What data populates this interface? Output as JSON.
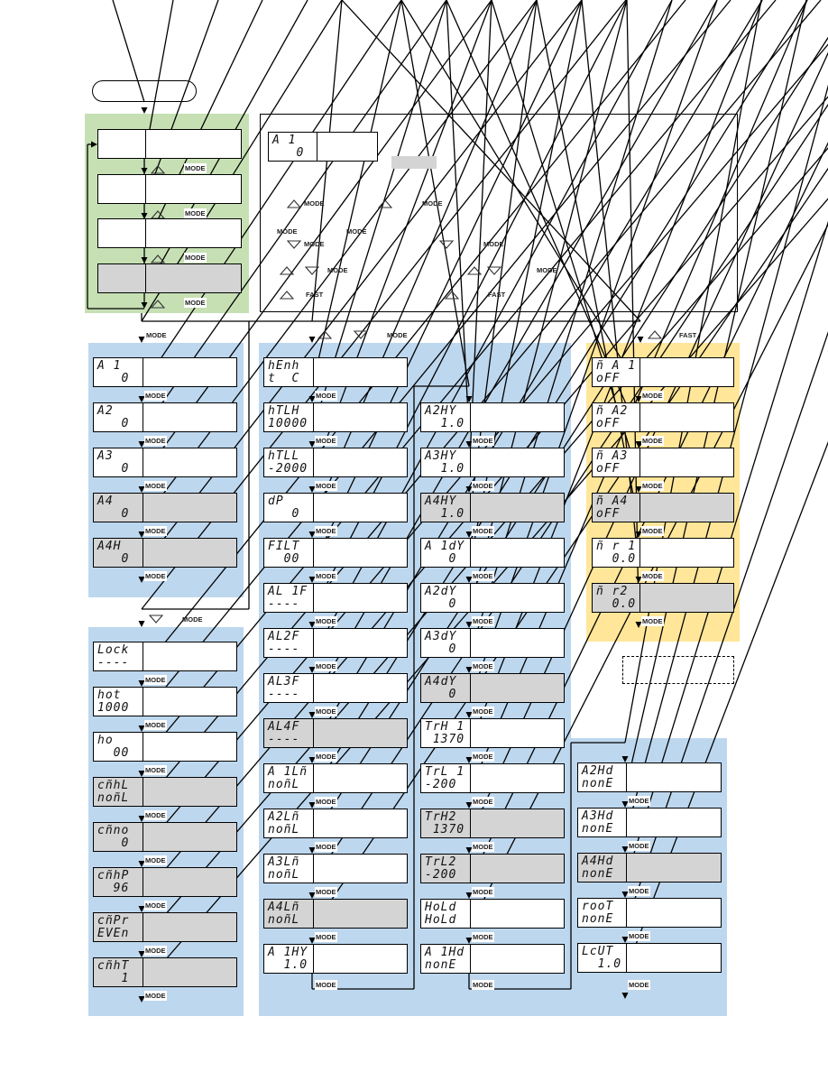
{
  "colors": {
    "green_panel": "#c6e0b4",
    "blue_panel": "#bdd7ee",
    "yellow_panel": "#ffe699",
    "shaded_box": "#d4d4d4"
  },
  "labels": {
    "mode": "MODE",
    "fast": "FAST"
  },
  "icons": {
    "up": "up-triangle-icon",
    "down": "down-triangle-icon"
  },
  "legend": {
    "sample": {
      "top": "A 1",
      "bottom": "   0"
    },
    "rows": [
      [
        "up",
        "MODE",
        "up",
        "MODE"
      ],
      [
        "MODE",
        "MODE"
      ],
      [
        "down",
        "MODE",
        "down",
        "MODE"
      ],
      [
        "up",
        "down",
        "MODE",
        "up",
        "down",
        "MODE"
      ],
      [
        "up",
        "FAST",
        "up",
        "FAST"
      ]
    ]
  },
  "green": {
    "items": [
      {
        "shaded": false
      },
      {
        "shaded": false
      },
      {
        "shaded": false
      },
      {
        "shaded": true
      }
    ]
  },
  "col1": {
    "items": [
      {
        "top": "A 1",
        "bottom": "   0",
        "shaded": false
      },
      {
        "top": "A2",
        "bottom": "   0",
        "shaded": false
      },
      {
        "top": "A3",
        "bottom": "   0",
        "shaded": false
      },
      {
        "top": "A4",
        "bottom": "   0",
        "shaded": true
      },
      {
        "top": "A4H",
        "bottom": "   0",
        "shaded": true
      }
    ]
  },
  "col1b": {
    "items": [
      {
        "top": "Lock",
        "bottom": "----",
        "shaded": false
      },
      {
        "top": "hot",
        "bottom": "1000",
        "shaded": false
      },
      {
        "top": "ho",
        "bottom": "  00",
        "shaded": false
      },
      {
        "top": "cñhL",
        "bottom": "noñL",
        "shaded": true
      },
      {
        "top": "cñno",
        "bottom": "   0",
        "shaded": true
      },
      {
        "top": "cñhP",
        "bottom": "  96",
        "shaded": true
      },
      {
        "top": "cñPr",
        "bottom": "EVEn",
        "shaded": true
      },
      {
        "top": "cñhT",
        "bottom": "   1",
        "shaded": true
      }
    ]
  },
  "col2a": {
    "items": [
      {
        "top": "hEnh",
        "bottom": "t  C",
        "shaded": false
      },
      {
        "top": "hTLH",
        "bottom": "10000",
        "shaded": false
      },
      {
        "top": "hTLL",
        "bottom": "-2000",
        "shaded": false
      },
      {
        "top": "dP",
        "bottom": "   0",
        "shaded": false
      },
      {
        "top": "FILT",
        "bottom": "  00",
        "shaded": false
      },
      {
        "top": "AL 1F",
        "bottom": "----",
        "shaded": false
      },
      {
        "top": "AL2F",
        "bottom": "----",
        "shaded": false
      },
      {
        "top": "AL3F",
        "bottom": "----",
        "shaded": false
      },
      {
        "top": "AL4F",
        "bottom": "----",
        "shaded": true
      },
      {
        "top": "A 1Lñ",
        "bottom": "noñL",
        "shaded": false
      },
      {
        "top": "A2Lñ",
        "bottom": "noñL",
        "shaded": false
      },
      {
        "top": "A3Lñ",
        "bottom": "noñL",
        "shaded": false
      },
      {
        "top": "A4Lñ",
        "bottom": "noñL",
        "shaded": true
      },
      {
        "top": "A 1HY",
        "bottom": "  1.0",
        "shaded": false
      }
    ]
  },
  "col2b": {
    "items": [
      {
        "top": "A2HY",
        "bottom": "  1.0",
        "shaded": false
      },
      {
        "top": "A3HY",
        "bottom": "  1.0",
        "shaded": false
      },
      {
        "top": "A4HY",
        "bottom": "  1.0",
        "shaded": true
      },
      {
        "top": "A 1dY",
        "bottom": "   0",
        "shaded": false
      },
      {
        "top": "A2dY",
        "bottom": "   0",
        "shaded": false
      },
      {
        "top": "A3dY",
        "bottom": "   0",
        "shaded": false
      },
      {
        "top": "A4dY",
        "bottom": "   0",
        "shaded": true
      },
      {
        "top": "TrH 1",
        "bottom": " 1370",
        "shaded": false
      },
      {
        "top": "TrL 1",
        "bottom": "-200",
        "shaded": false
      },
      {
        "top": "TrH2",
        "bottom": " 1370",
        "shaded": true
      },
      {
        "top": "TrL2",
        "bottom": "-200",
        "shaded": true
      },
      {
        "top": "HoLd",
        "bottom": "HoLd",
        "shaded": false
      },
      {
        "top": "A 1Hd",
        "bottom": "nonE",
        "shaded": false
      }
    ]
  },
  "col3": {
    "items": [
      {
        "top": "A2Hd",
        "bottom": "nonE",
        "shaded": false
      },
      {
        "top": "A3Hd",
        "bottom": "nonE",
        "shaded": false
      },
      {
        "top": "A4Hd",
        "bottom": "nonE",
        "shaded": true
      },
      {
        "top": "rooT",
        "bottom": "nonE",
        "shaded": false
      },
      {
        "top": "LcUT",
        "bottom": "  1.0",
        "shaded": false
      }
    ]
  },
  "yellow": {
    "items": [
      {
        "top": "ñ A 1",
        "bottom": "oFF",
        "shaded": false
      },
      {
        "top": "ñ A2",
        "bottom": "oFF",
        "shaded": false
      },
      {
        "top": "ñ A3",
        "bottom": "oFF",
        "shaded": false
      },
      {
        "top": "ñ A4",
        "bottom": "oFF",
        "shaded": true
      },
      {
        "top": "ñ r 1",
        "bottom": "  0.0",
        "shaded": false
      },
      {
        "top": "ñ r2",
        "bottom": "  0.0",
        "shaded": true
      }
    ]
  }
}
